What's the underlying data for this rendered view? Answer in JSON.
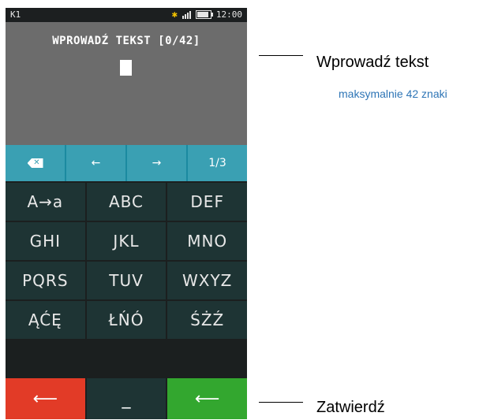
{
  "status": {
    "left": "K1",
    "time": "12:00",
    "icons": [
      "bluetooth-icon",
      "signal-icon",
      "battery-icon"
    ]
  },
  "screen": {
    "prompt": "WPROWADŹ TEKST [0/42]"
  },
  "nav_row": [
    {
      "name": "backspace-button",
      "icon": "backspace-icon",
      "label": ""
    },
    {
      "name": "cursor-left-button",
      "icon": "arrow-left-icon",
      "label": "←"
    },
    {
      "name": "cursor-right-button",
      "icon": "arrow-right-icon",
      "label": "→"
    },
    {
      "name": "page-button",
      "label": "1/3"
    }
  ],
  "letter_rows": [
    [
      "A→a",
      "ABC",
      "DEF"
    ],
    [
      "GHI",
      "JKL",
      "MNO"
    ],
    [
      "PQRS",
      "TUV",
      "WXYZ"
    ],
    [
      "ĄĆĘ",
      "ŁŃÓ",
      "ŚŻŹ"
    ]
  ],
  "bottom_row": {
    "cancel_label": "⟵",
    "space_label": "_",
    "confirm_label": "⟵"
  },
  "callouts": {
    "input": {
      "title": "Wprowadź tekst",
      "subtitle": "maksymalnie 42 znaki"
    },
    "confirm": {
      "title": "Zatwierdź"
    }
  },
  "colors": {
    "nav": "#3aa0b3",
    "keys": "#1e3434",
    "cancel": "#e23b27",
    "confirm": "#33a72f",
    "subtitle": "#2e75b6"
  }
}
